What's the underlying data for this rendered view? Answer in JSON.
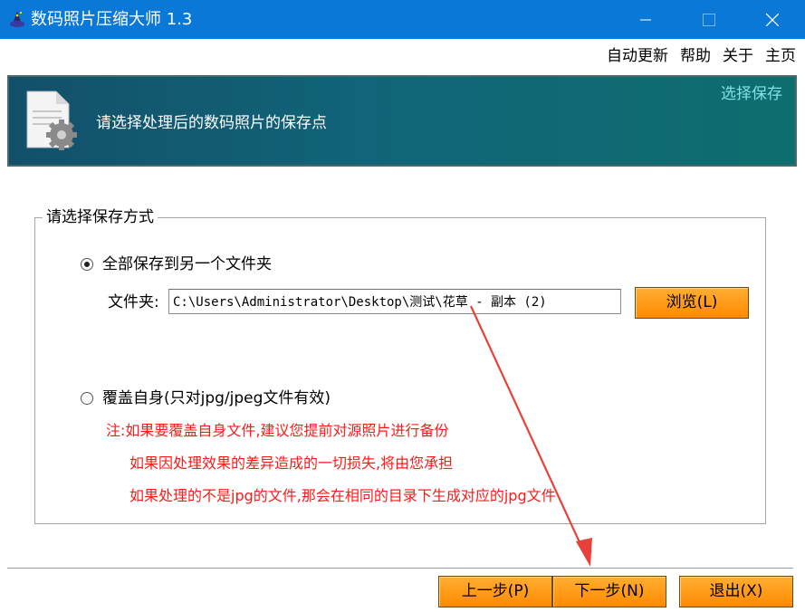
{
  "window": {
    "title": "数码照片压缩大师 1.3",
    "min_glyph": "—",
    "max_glyph": "☐",
    "close_glyph": "✕"
  },
  "menu": {
    "items": [
      "自动更新",
      "帮助",
      "关于",
      "主页"
    ]
  },
  "banner": {
    "tagline": "请选择处理后的数码照片的保存点",
    "step": "选择保存"
  },
  "save_group": {
    "legend": "请选择保存方式",
    "option_folder": "全部保存到另一个文件夹",
    "folder_label": "文件夹:",
    "folder_value": "C:\\Users\\Administrator\\Desktop\\测试\\花草 - 副本 (2)",
    "browse_label": "浏览(L)",
    "option_overwrite": "覆盖自身(只对jpg/jpeg文件有效)",
    "note_1": "注:如果要覆盖自身文件,建议您提前对源照片进行备份",
    "note_2": "如果因处理效果的差异造成的一切损失,将由您承担",
    "note_3": "如果处理的不是jpg的文件,那会在相同的目录下生成对应的jpg文件"
  },
  "footer": {
    "prev_label": "上一步(P)",
    "next_label": "下一步(N)",
    "exit_label": "退出(X)"
  },
  "colors": {
    "titlebar": "#0a78d7",
    "button_orange": "#ff9a1a",
    "note_red": "#ff1a1a",
    "annotation_arrow": "#e8413a"
  },
  "state": {
    "selected_option": "option_folder"
  }
}
